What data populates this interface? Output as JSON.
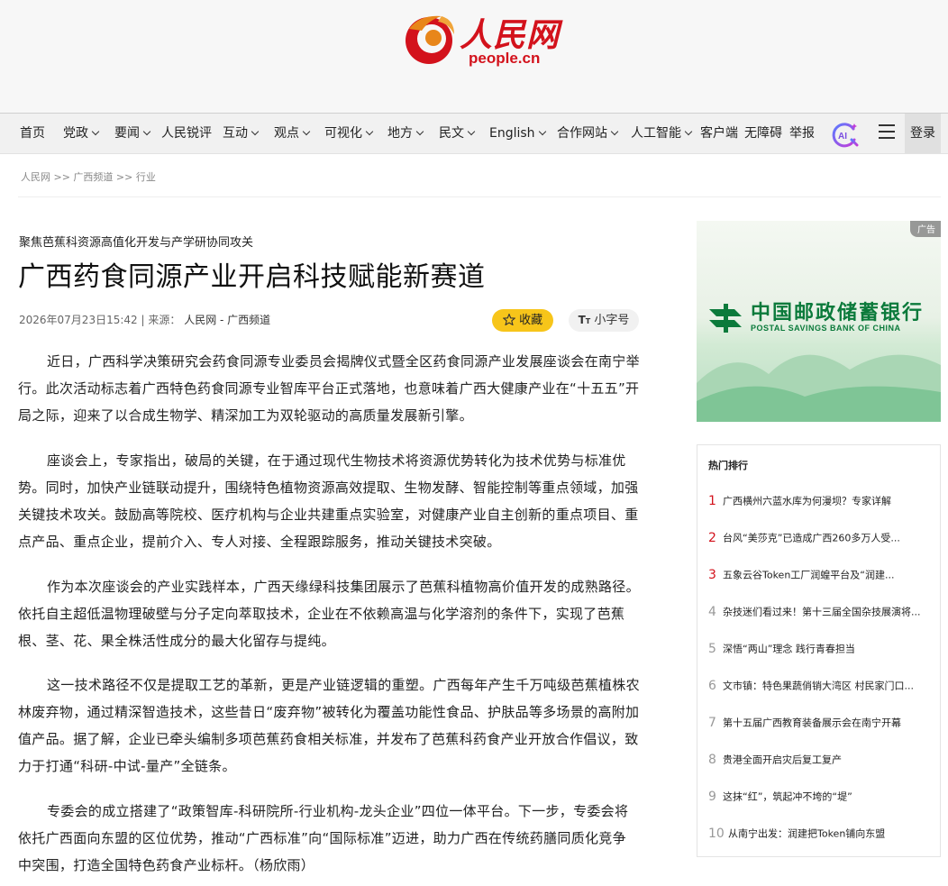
{
  "header": {
    "logo_cn": "人民网",
    "logo_en": "people.cn"
  },
  "nav": {
    "items": [
      {
        "label": "首页",
        "dropdown": false
      },
      {
        "label": "党政",
        "dropdown": true
      },
      {
        "label": "要闻",
        "dropdown": true
      },
      {
        "label": "人民锐评",
        "dropdown": false
      },
      {
        "label": "互动",
        "dropdown": true
      },
      {
        "label": "观点",
        "dropdown": true
      },
      {
        "label": "可视化",
        "dropdown": true
      },
      {
        "label": "地方",
        "dropdown": true
      },
      {
        "label": "民文",
        "dropdown": true
      },
      {
        "label": "English",
        "dropdown": true
      },
      {
        "label": "合作网站",
        "dropdown": true
      },
      {
        "label": "人工智能",
        "dropdown": true
      },
      {
        "label": "客户端",
        "dropdown": false
      },
      {
        "label": "无障碍",
        "dropdown": false
      },
      {
        "label": "举报",
        "dropdown": false
      }
    ],
    "login_label": "登录"
  },
  "breadcrumb": "人民网 >> 广西频道 >> 行业",
  "article": {
    "kicker": "聚焦芭蕉科资源高值化开发与产学研协同攻关",
    "title": "广西药食同源产业开启科技赋能新赛道",
    "datetime": "2026年07月23日15:42",
    "source_prefix": "| 来源：",
    "source": "人民网 - 广西频道",
    "favorite_label": "收藏",
    "font_size_label": "小字号",
    "paragraphs": [
      "近日，广西科学决策研究会药食同源专业委员会揭牌仪式暨全区药食同源产业发展座谈会在南宁举行。此次活动标志着广西特色药食同源专业智库平台正式落地，也意味着广西大健康产业在“十五五”开局之际，迎来了以合成生物学、精深加工为双轮驱动的高质量发展新引擎。",
      "座谈会上，专家指出，破局的关键，在于通过现代生物技术将资源优势转化为技术优势与标准优势。同时，加快产业链联动提升，围绕特色植物资源高效提取、生物发酵、智能控制等重点领域，加强关键技术攻关。鼓励高等院校、医疗机构与企业共建重点实验室，对健康产业自主创新的重点项目、重点产品、重点企业，提前介入、专人对接、全程跟踪服务，推动关键技术突破。",
      "作为本次座谈会的产业实践样本，广西天缘绿科技集团展示了芭蕉科植物高价值开发的成熟路径。依托自主超低温物理破壁与分子定向萃取技术，企业在不依赖高温与化学溶剂的条件下，实现了芭蕉根、茎、花、果全株活性成分的最大化留存与提纯。",
      "这一技术路径不仅是提取工艺的革新，更是产业链逻辑的重塑。广西每年产生千万吨级芭蕉植株农林废弃物，通过精深智造技术，这些昔日“废弃物”被转化为覆盖功能性食品、护肤品等多场景的高附加值产品。据了解，企业已牵头编制多项芭蕉药食相关标准，并发布了芭蕉科药食产业开放合作倡议，致力于打通“科研-中试-量产”全链条。",
      "专委会的成立搭建了“政策智库-科研院所-行业机构-龙头企业”四位一体平台。下一步，专委会将依托广西面向东盟的区位优势，推动“广西标准”向“国际标准”迈进，助力广西在传统药膳同质化竞争中突围，打造全国特色药食产业标杆。（杨欣雨）"
    ]
  },
  "ad": {
    "tag": "广告",
    "name_cn": "中国邮政储蓄银行",
    "name_en": "POSTAL SAVINGS BANK OF CHINA",
    "brand_color": "#0b7a3b"
  },
  "hot": {
    "title": "热门排行",
    "items": [
      {
        "rank": "1",
        "text": "广西横州六蓝水库为何漫坝？专家详解"
      },
      {
        "rank": "2",
        "text": "台风“美莎克”已造成广西260多万人受..."
      },
      {
        "rank": "3",
        "text": "五象云谷Token工厂润蝗平台及“润建..."
      },
      {
        "rank": "4",
        "text": "杂技迷们看过来！第十三届全国杂技展演将..."
      },
      {
        "rank": "5",
        "text": "深悟“两山”理念 践行青春担当"
      },
      {
        "rank": "6",
        "text": "文市镇：特色果蔬俏销大湾区 村民家门口..."
      },
      {
        "rank": "7",
        "text": "第十五届广西教育装备展示会在南宁开幕"
      },
      {
        "rank": "8",
        "text": "贵港全面开启灾后复工复产"
      },
      {
        "rank": "9",
        "text": "这抹“红”，筑起冲不垮的“堤”"
      },
      {
        "rank": "10",
        "text": "从南宁出发：润建把Token铺向东盟"
      }
    ]
  },
  "colors": {
    "accent_red": "#d3121c",
    "favorite_yellow": "#f7c51a"
  }
}
